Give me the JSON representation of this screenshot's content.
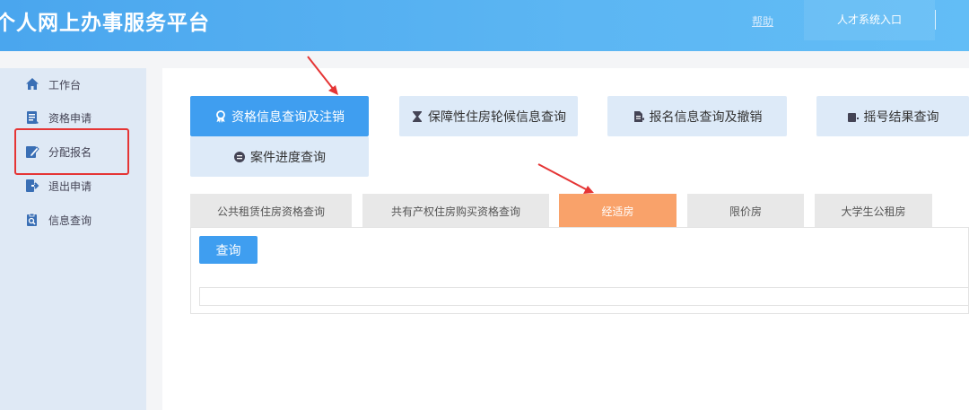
{
  "header": {
    "title": "个人网上办事服务平台",
    "help": "帮助",
    "talent_entry": "人才系统入口"
  },
  "sidebar": {
    "items": [
      {
        "label": "工作台",
        "icon": "home-icon"
      },
      {
        "label": "资格申请",
        "icon": "document-icon"
      },
      {
        "label": "分配报名",
        "icon": "edit-icon"
      },
      {
        "label": "退出申请",
        "icon": "exit-icon"
      },
      {
        "label": "信息查询",
        "icon": "clipboard-search-icon"
      }
    ]
  },
  "categories": [
    {
      "label": "资格信息查询及注销",
      "icon": "award-icon",
      "active": true
    },
    {
      "label": "保障性住房轮候信息查询",
      "icon": "hourglass-icon",
      "active": false
    },
    {
      "label": "报名信息查询及撤销",
      "icon": "file-edit-icon",
      "active": false
    },
    {
      "label": "摇号结果查询",
      "icon": "lottery-icon",
      "active": false
    },
    {
      "label": "案件进度查询",
      "icon": "progress-icon",
      "active": false
    }
  ],
  "tabs": [
    {
      "label": "公共租赁住房资格查询",
      "active": false
    },
    {
      "label": "共有产权住房购买资格查询",
      "active": false
    },
    {
      "label": "经适房",
      "active": true
    },
    {
      "label": "限价房",
      "active": false
    },
    {
      "label": "大学生公租房",
      "active": false
    }
  ],
  "query_button": "查询",
  "colors": {
    "header_bg": "#56b2f2",
    "primary": "#3f9ef0",
    "active_tab": "#f9a26a",
    "highlight": "#e53535",
    "sidebar_bg": "#dfe9f5"
  }
}
